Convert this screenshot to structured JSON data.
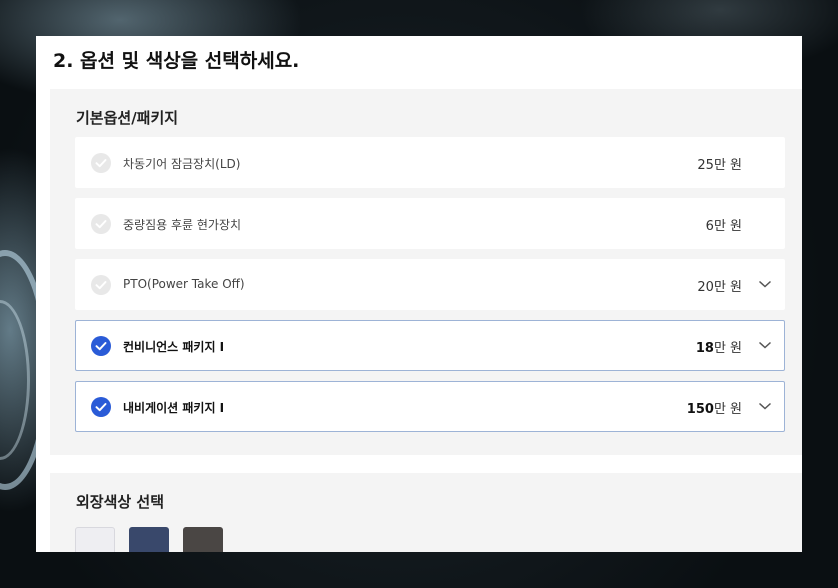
{
  "page": {
    "title": "2. 옵션 및 색상을 선택하세요."
  },
  "options_section": {
    "title": "기본옵션/패키지",
    "items": [
      {
        "label": "차동기어 잠금장치(LD)",
        "price_num": "25",
        "price_unit": "만 원",
        "selected": false,
        "expandable": false
      },
      {
        "label": "중량짐용 후륜 현가장치",
        "price_num": "6",
        "price_unit": "만 원",
        "selected": false,
        "expandable": false
      },
      {
        "label": "PTO(Power Take Off)",
        "price_num": "20",
        "price_unit": "만 원",
        "selected": false,
        "expandable": true
      },
      {
        "label": "컨비니언스 패키지 I",
        "price_num": "18",
        "price_unit": "만 원",
        "selected": true,
        "expandable": true
      },
      {
        "label": "내비게이션 패키지 I",
        "price_num": "150",
        "price_unit": "만 원",
        "selected": true,
        "expandable": true
      }
    ]
  },
  "colors_section": {
    "title": "외장색상 선택",
    "swatches": [
      {
        "name": "white",
        "color": "#eeeef2"
      },
      {
        "name": "navy",
        "color": "#39486b"
      },
      {
        "name": "dark-gray",
        "color": "#4a4644"
      }
    ]
  },
  "theme": {
    "accent": "#2a5bd7",
    "selected_border": "#9db3d6",
    "section_bg": "#f4f4f4"
  },
  "icons": {
    "check": "check-circle-icon",
    "expand": "chevron-down-icon"
  }
}
